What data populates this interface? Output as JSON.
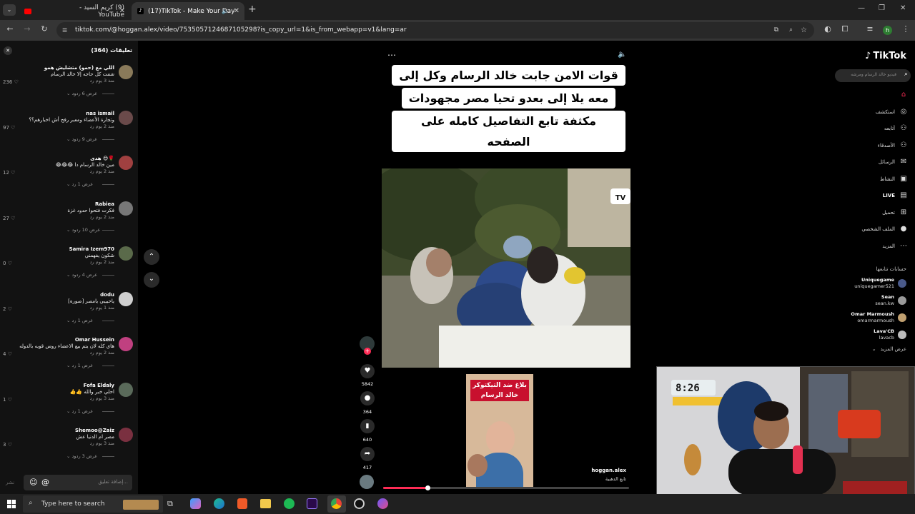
{
  "tabs": [
    {
      "title": "(9) كريم السيد - YouTube"
    },
    {
      "title": "(17)TikTok - Make Your Day"
    }
  ],
  "url": "tiktok.com/@hoggan.alex/video/7535057124687105298?is_copy_url=1&is_from_webapp=v1&lang=ar",
  "profile_initial": "h",
  "comments": {
    "header": "تعليقات (364)",
    "items": [
      {
        "name": "اللي مع (حمو) متشليش همو",
        "text": "شفت كل حاجه إلا خالد الرسام",
        "meta": "منذ 3 يوم   رد",
        "likes": "236",
        "replies": "عرض 6 ردود",
        "avatar_color": "#8a7a5a"
      },
      {
        "name": "nas ismail",
        "text": "وتجارة الأعضاء ومعبر رفح أش اخبارهم؟؟",
        "meta": "منذ 2 يوم   رد",
        "likes": "97",
        "replies": "عرض 9 ردود",
        "avatar_color": "#6a4a4a"
      },
      {
        "name": "هدى 😍🌹",
        "text": "مين خالد الرسام دا 😂😂😂",
        "meta": "منذ 2 يوم   رد",
        "likes": "12",
        "replies": "عرض 1 رد",
        "avatar_color": "#a04040"
      },
      {
        "name": "Rabiea",
        "text": "فكرت فتحوا حدود غزة",
        "meta": "منذ 2 يوم   رد",
        "likes": "27",
        "replies": "عرض 10 ردود",
        "avatar_color": "#777"
      },
      {
        "name": "Samira Izem970",
        "text": "شكون يفهمني",
        "meta": "منذ 2 يوم   رد",
        "likes": "0",
        "replies": "عرض 4 ردود",
        "avatar_color": "#5a6a4a"
      },
      {
        "name": "dodu",
        "text": "ياحبيبي يامصر [صورة]",
        "meta": "منذ 1 يوم   رد",
        "likes": "2",
        "replies": "عرض 1 رد",
        "avatar_color": "#cfcfcf"
      },
      {
        "name": "Omar Hussein",
        "text": "هاي كله لان يتم بيع الاعضاء روس قويه بالدوله",
        "meta": "منذ 2 يوم   رد",
        "likes": "4",
        "replies": "عرض 1 رد",
        "avatar_color": "#c04080"
      },
      {
        "name": "Fofa Eldaly",
        "text": "احلي خبر والله 👍👍",
        "meta": "منذ 3 يوم   رد",
        "likes": "1",
        "replies": "عرض 1 رد",
        "avatar_color": "#5a6a5a"
      },
      {
        "name": "Shemoo@Zaiz",
        "text": "مصر ام الدنيا عش",
        "meta": "منذ 3 يوم   رد",
        "likes": "3",
        "replies": "عرض 3 ردود",
        "avatar_color": "#7a3040"
      }
    ],
    "input_placeholder": "إضافة تعليق...",
    "post_label": "نشر"
  },
  "video": {
    "caption_lines": [
      "قوات الامن جابت خالد الرسام وكل إلى",
      "معه يلا إلى بعدو تحيا مصر مجهودات",
      "مكثفة تابع التفاصيل كامله على الصفحه"
    ],
    "thumb_title": "بلاغ ضد التيكتوكر خالد الرسام",
    "likes": "5842",
    "comments": "364",
    "saves": "640",
    "shares": "417",
    "author": "hoggan.alex",
    "author_sub": "تابع الدهبية",
    "progress": 0.18
  },
  "nav": {
    "logo": "TikTok",
    "search_placeholder": "فيديو خالد الرسام ومرشه",
    "items": [
      {
        "label": "",
        "icon": "home-icon"
      },
      {
        "label": "استكشف",
        "icon": "explore-icon"
      },
      {
        "label": "أتابعه",
        "icon": "following-icon"
      },
      {
        "label": "الأصدقاء",
        "icon": "friends-icon"
      },
      {
        "label": "الرسائل",
        "icon": "messages-icon"
      },
      {
        "label": "النشاط",
        "icon": "activity-icon"
      },
      {
        "label": "LIVE",
        "icon": "live-icon"
      },
      {
        "label": "تحميل",
        "icon": "upload-icon"
      },
      {
        "label": "الملف الشخصي",
        "icon": "profile-icon"
      },
      {
        "label": "المزيد",
        "icon": "more-icon"
      }
    ],
    "following_header": "حسابات تتابعها",
    "following": [
      {
        "name": "Uniquegame",
        "handle": "uniquegamer521"
      },
      {
        "name": "Sean",
        "handle": "sean.kw"
      },
      {
        "name": "Omar Marmoush",
        "handle": "omarmarmoush"
      },
      {
        "name": "Lava'CB",
        "handle": "lavacb"
      }
    ],
    "see_more": "عرض المزيد"
  },
  "webcam_clock": "8:26",
  "taskbar": {
    "search_placeholder": "Type here to search"
  }
}
